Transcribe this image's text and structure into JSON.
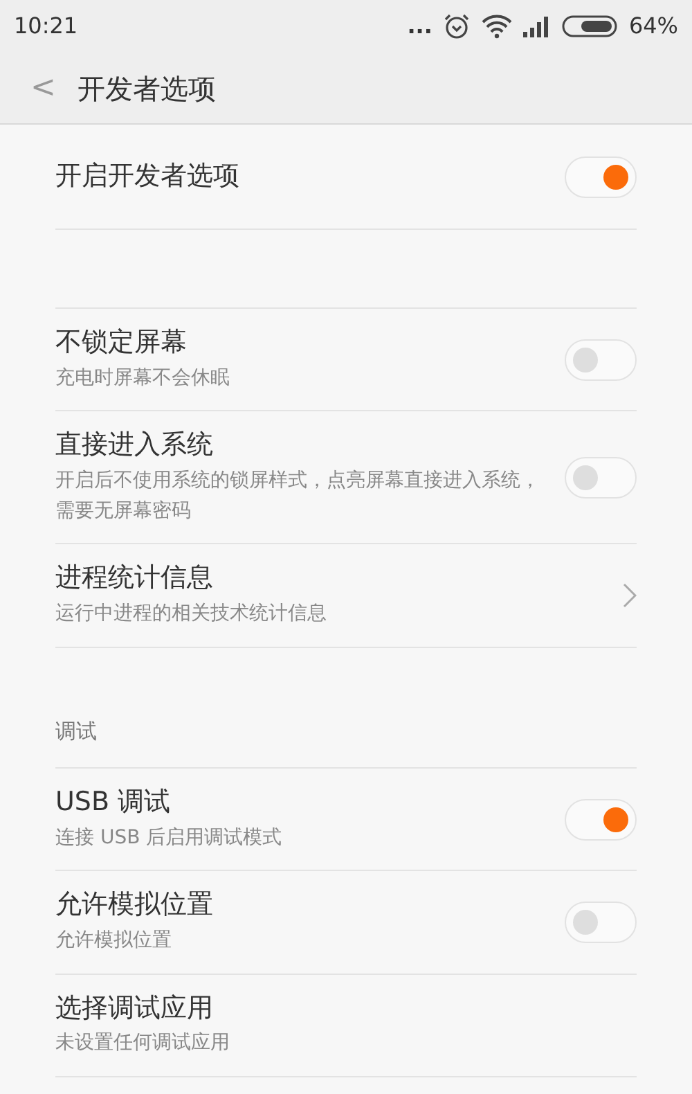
{
  "status_bar": {
    "time": "10:21",
    "dots": "...",
    "battery_text": "64%"
  },
  "header": {
    "back": "<",
    "title": "开发者选项"
  },
  "items": [
    {
      "kind": "toggle",
      "title": "开启开发者选项",
      "on": true
    },
    {
      "kind": "spacer"
    },
    {
      "kind": "toggle",
      "title": "不锁定屏幕",
      "subtitle": "充电时屏幕不会休眠",
      "on": false
    },
    {
      "kind": "toggle",
      "title": "直接进入系统",
      "subtitle": "开启后不使用系统的锁屏样式，点亮屏幕直接进入系统，需要无屏幕密码",
      "on": false
    },
    {
      "kind": "link",
      "title": "进程统计信息",
      "subtitle": "运行中进程的相关技术统计信息"
    },
    {
      "kind": "section",
      "title": "调试"
    },
    {
      "kind": "toggle",
      "title": "USB 调试",
      "subtitle": "连接 USB 后启用调试模式",
      "on": true
    },
    {
      "kind": "toggle",
      "title": "允许模拟位置",
      "subtitle": "允许模拟位置",
      "on": false
    },
    {
      "kind": "plain",
      "title": "选择调试应用",
      "subtitle": "未设置任何调试应用"
    }
  ]
}
